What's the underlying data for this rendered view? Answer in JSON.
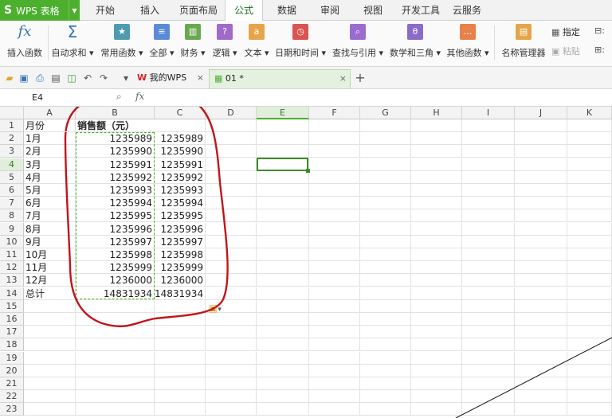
{
  "app": {
    "logo": "S",
    "name": "WPS 表格"
  },
  "menu_tabs": [
    "开始",
    "插入",
    "页面布局",
    "公式",
    "数据",
    "审阅",
    "视图",
    "开发工具",
    "云服务"
  ],
  "active_tab": "公式",
  "ribbon": {
    "insert_function": "插入函数",
    "autosum": "自动求和",
    "common": "常用函数",
    "all": "全部",
    "finance": "财务",
    "logic": "逻辑",
    "text": "文本",
    "datetime": "日期和时间",
    "lookup": "查找与引用",
    "math": "数学和三角",
    "other": "其他函数",
    "name_manager": "名称管理器",
    "specify": "指定",
    "paste": "粘贴"
  },
  "doc_tabs": [
    "我的WPS",
    "01 *"
  ],
  "name_box": "E4",
  "formula_icons": {
    "zoom": "search-icon",
    "fx": "fx"
  },
  "columns": [
    "A",
    "B",
    "C",
    "D",
    "E",
    "F",
    "G",
    "H",
    "I",
    "J",
    "K"
  ],
  "selected_column": "E",
  "selected_row": "4",
  "rows": [
    "1",
    "2",
    "3",
    "4",
    "5",
    "6",
    "7",
    "8",
    "9",
    "10",
    "11",
    "12",
    "13",
    "14",
    "15",
    "16",
    "17",
    "18",
    "19",
    "20",
    "21",
    "22",
    "23"
  ],
  "table": {
    "header": [
      "月份",
      "销售额（元）"
    ],
    "data": [
      [
        "1月",
        "1235989",
        "1235989"
      ],
      [
        "2月",
        "1235990",
        "1235990"
      ],
      [
        "3月",
        "1235991",
        "1235991"
      ],
      [
        "4月",
        "1235992",
        "1235992"
      ],
      [
        "5月",
        "1235993",
        "1235993"
      ],
      [
        "6月",
        "1235994",
        "1235994"
      ],
      [
        "7月",
        "1235995",
        "1235995"
      ],
      [
        "8月",
        "1235996",
        "1235996"
      ],
      [
        "9月",
        "1235997",
        "1235997"
      ],
      [
        "10月",
        "1235998",
        "1235998"
      ],
      [
        "11月",
        "1235999",
        "1235999"
      ],
      [
        "12月",
        "1236000",
        "1236000"
      ],
      [
        "总计",
        "14831934",
        "14831934"
      ]
    ]
  },
  "colors": {
    "accent": "#4caf2e",
    "annotation": "#c0151b",
    "copy_border": "#4caf2e"
  }
}
